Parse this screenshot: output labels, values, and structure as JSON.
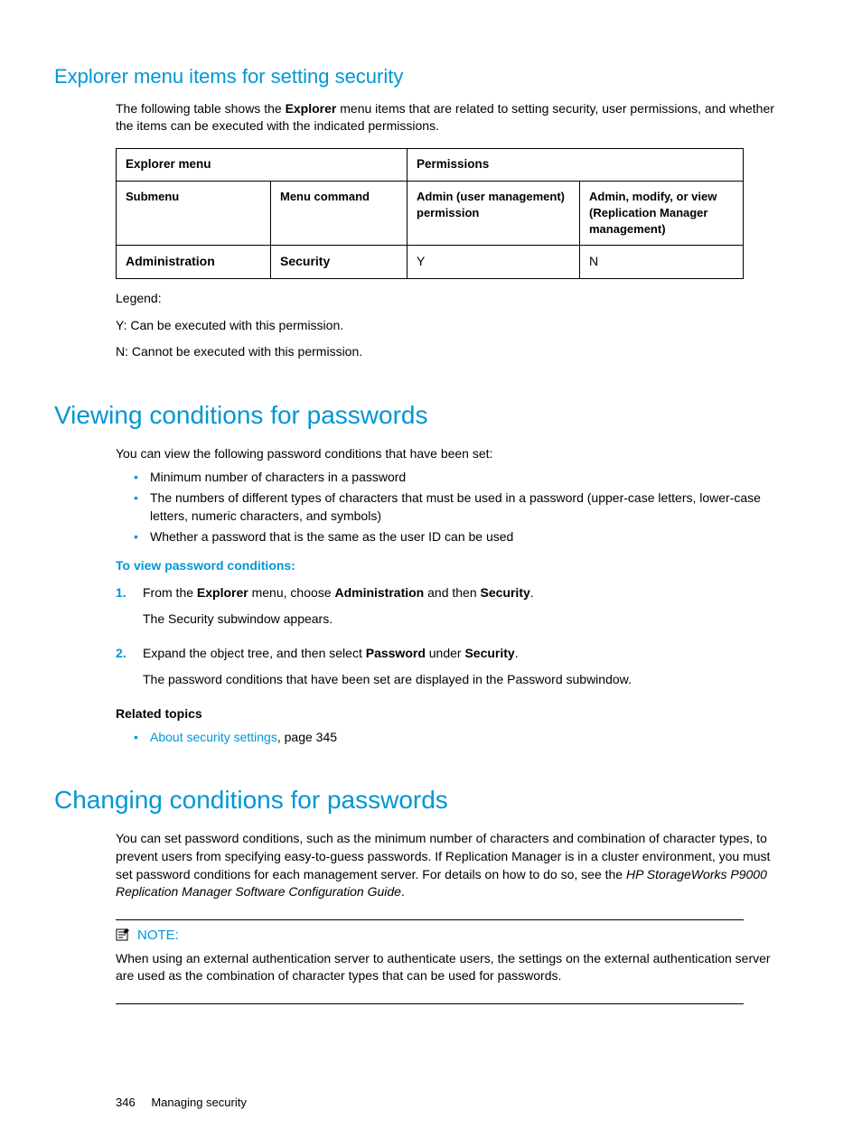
{
  "h2_explorer": "Explorer menu items for setting security",
  "p_explorer_intro_a": "The following table shows the ",
  "p_explorer_intro_b": "Explorer",
  "p_explorer_intro_c": " menu items that are related to setting security, user permissions, and whether the items can be executed with the indicated permissions.",
  "table": {
    "h_explorer": "Explorer menu",
    "h_perm": "Permissions",
    "h_submenu": "Submenu",
    "h_menucmd": "Menu command",
    "h_adminuser": "Admin (user management) permission",
    "h_adminmod": "Admin, modify, or view (Replication Manager management)",
    "r_admin": "Administration",
    "r_security": "Security",
    "r_y": "Y",
    "r_n": "N"
  },
  "legend": {
    "title": "Legend:",
    "y": "Y: Can be executed with this permission.",
    "n": "N: Cannot be executed with this permission."
  },
  "h1_viewing": "Viewing conditions for passwords",
  "p_view_intro": "You can view the following password conditions that have been set:",
  "view_bullets": {
    "b1": "Minimum number of characters in a password",
    "b2": "The numbers of different types of characters that must be used in a password (upper-case letters, lower-case letters, numeric characters, and symbols)",
    "b3": "Whether a password that is the same as the user ID can be used"
  },
  "proc_view_title": "To view password conditions:",
  "step1_a": "From the ",
  "step1_b": "Explorer",
  "step1_c": " menu, choose ",
  "step1_d": "Administration",
  "step1_e": " and then ",
  "step1_f": "Security",
  "step1_g": ".",
  "step1_res": "The Security subwindow appears.",
  "step2_a": "Expand the object tree, and then select ",
  "step2_b": "Password",
  "step2_c": " under ",
  "step2_d": "Security",
  "step2_e": ".",
  "step2_res": "The password conditions that have been set are displayed in the Password subwindow.",
  "related_title": "Related topics",
  "related_link": "About security settings",
  "related_page": ", page 345",
  "h1_changing": "Changing conditions for passwords",
  "p_change_a": "You can set password conditions, such as the minimum number of characters and combination of character types, to prevent users from specifying easy-to-guess passwords. If Replication Manager is in a cluster environment, you must set password conditions for each management server. For details on how to do so, see the ",
  "p_change_b": "HP StorageWorks P9000 Replication Manager Software Configuration Guide",
  "p_change_c": ".",
  "note_label": "NOTE:",
  "note_text": "When using an external authentication server to authenticate users, the settings on the external authentication server are used as the combination of character types that can be used for passwords.",
  "footer_page": "346",
  "footer_sec": "Managing security"
}
